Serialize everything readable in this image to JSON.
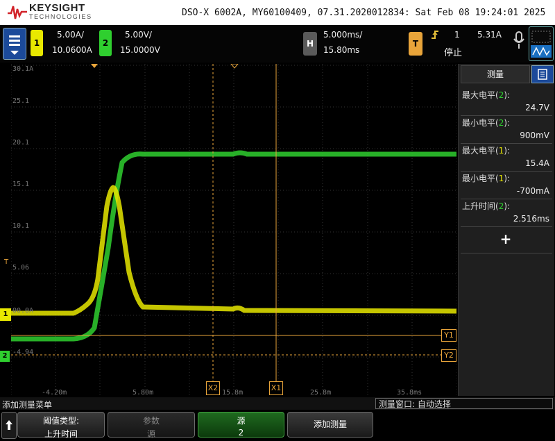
{
  "brand": {
    "name": "KEYSIGHT",
    "sub": "TECHNOLOGIES"
  },
  "title": "DSO-X 6002A, MY60100409, 07.31.2020012834: Sat Feb 08 19:24:01 2025",
  "ch1": {
    "num": "1",
    "scale": "5.00A/",
    "offset": "10.0600A",
    "color": "#e8e800"
  },
  "ch2": {
    "num": "2",
    "scale": "5.00V/",
    "offset": "15.0000V",
    "color": "#2fcf2f"
  },
  "horizontal": {
    "label": "H",
    "scale": "5.000ms/",
    "delay": "15.80ms"
  },
  "trigger": {
    "label": "T",
    "source": "1",
    "level": "5.31A",
    "state": "停止",
    "edge_icon": "rising-edge-icon"
  },
  "plot": {
    "y_labels": [
      "30.1A",
      "25.1",
      "20.1",
      "15.1",
      "10.1",
      "5.06",
      "00.0A",
      "-4.94"
    ],
    "x_labels": [
      "-4.20m",
      "5.80m",
      "15.8m",
      "25.8m",
      "35.8ms"
    ],
    "markers": {
      "x1": "X1",
      "x2": "X2",
      "y1": "Y1",
      "y2": "Y2",
      "t": "T"
    }
  },
  "measurements": {
    "tab_label": "测量",
    "items": [
      {
        "label": "最大电平",
        "src": "2",
        "value": "24.7V"
      },
      {
        "label": "最小电平",
        "src": "2",
        "value": "900mV"
      },
      {
        "label": "最大电平",
        "src": "1",
        "value": "15.4A"
      },
      {
        "label": "最小电平",
        "src": "1",
        "value": "-700mA"
      },
      {
        "label": "上升时间",
        "src": "2",
        "value": "2.516ms"
      }
    ],
    "add_label": "+"
  },
  "status": {
    "left": "添加测量菜单",
    "right": "测量窗口: 自动选择"
  },
  "softkeys": [
    {
      "l1": "阈值类型:",
      "l2": "上升时间"
    },
    {
      "l1": "参数",
      "l2": "源"
    },
    {
      "l1": "源",
      "l2": "2"
    },
    {
      "l1": "添加测量",
      "l2": ""
    }
  ]
}
